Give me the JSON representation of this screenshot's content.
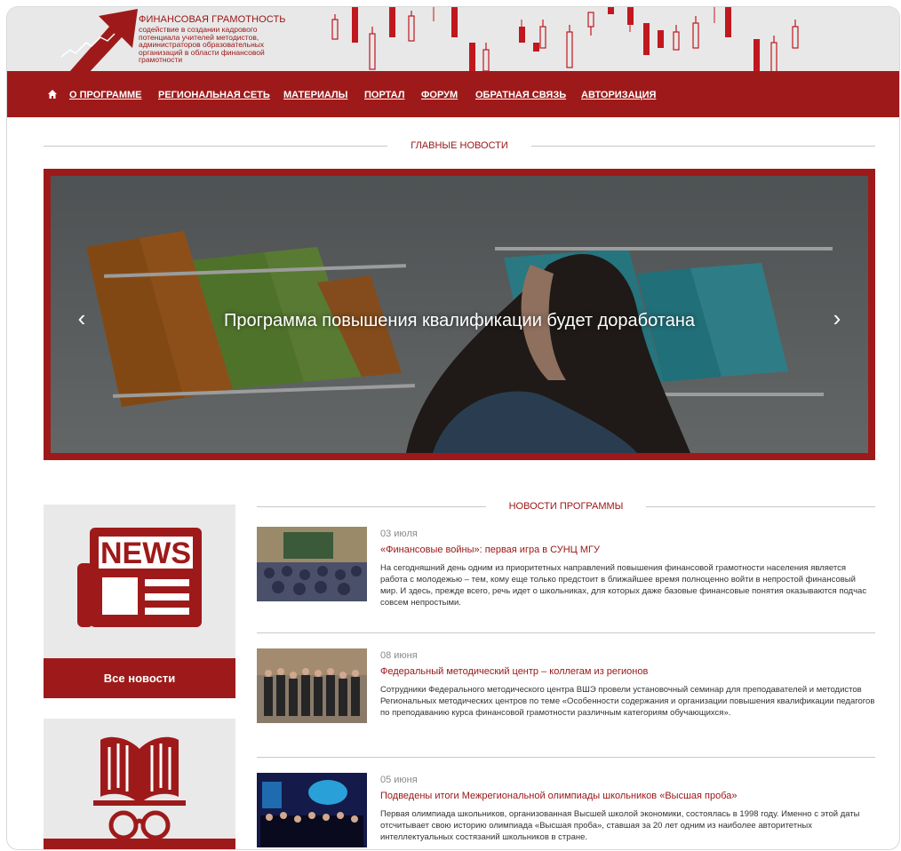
{
  "header": {
    "brand_title": "ФИНАНСОВАЯ ГРАМОТНОСТЬ",
    "brand_subtitle": "содействие в создании кадрового потенциала учителей методистов, администраторов образовательных организаций в области финансовой грамотности",
    "home_icon": "home-icon"
  },
  "nav": {
    "items": [
      {
        "label": "О ПРОГРАММЕ"
      },
      {
        "label": "РЕГИОНАЛЬНАЯ СЕТЬ"
      },
      {
        "label": "МАТЕРИАЛЫ"
      },
      {
        "label": "ПОРТАЛ"
      },
      {
        "label": "ФОРУМ"
      },
      {
        "label": "ОБРАТНАЯ СВЯЗЬ"
      },
      {
        "label": "АВТОРИЗАЦИЯ"
      }
    ]
  },
  "main_news": {
    "heading": "ГЛАВНЫЕ НОВОСТИ",
    "slide_caption": "Программа повышения квалификации будет доработана",
    "prev_icon": "chevron-left-icon",
    "next_icon": "chevron-right-icon"
  },
  "tiles": {
    "news": {
      "icon": "newspaper-icon",
      "icon_text": "NEWS",
      "label": "Все новости"
    },
    "library": {
      "icon": "book-glasses-icon"
    }
  },
  "program_news": {
    "heading": "НОВОСТИ ПРОГРАММЫ",
    "items": [
      {
        "date": "03 июля",
        "title": "«Финансовые войны»: первая игра в СУНЦ МГУ",
        "text": "На сегодняшний день одним из приоритетных направлений повышения финансовой грамотности населения является работа с молодежью – тем, кому еще только предстоит в ближайшее время полноценно войти в непростой финансовый мир. И здесь, прежде всего, речь идет о школьниках, для которых даже базовые финансовые понятия оказываются подчас совсем непростыми."
      },
      {
        "date": "08 июня",
        "title": "Федеральный методический центр – коллегам из регионов",
        "text": "Сотрудники Федерального методического центра ВШЭ провели установочный семинар для преподавателей и методистов Региональных методических центров по теме «Особенности содержания и организации повышения квалификации педагогов по преподаванию курса финансовой грамотности различным категориям обучающихся»."
      },
      {
        "date": "05 июня",
        "title": "Подведены итоги Межрегиональной олимпиады школьников «Высшая проба»",
        "text": "Первая олимпиада школьников, организованная Высшей школой экономики, состоялась в 1998 году. Именно с этой даты отсчитывает свою историю олимпиада «Высшая проба», ставшая за 20 лет одним из наиболее авторитетных интеллектуальных состязаний школьников в стране."
      }
    ]
  },
  "colors": {
    "brand_red": "#9e1a1a",
    "text_red": "#9b1414",
    "header_gray": "#e8e8e8"
  }
}
